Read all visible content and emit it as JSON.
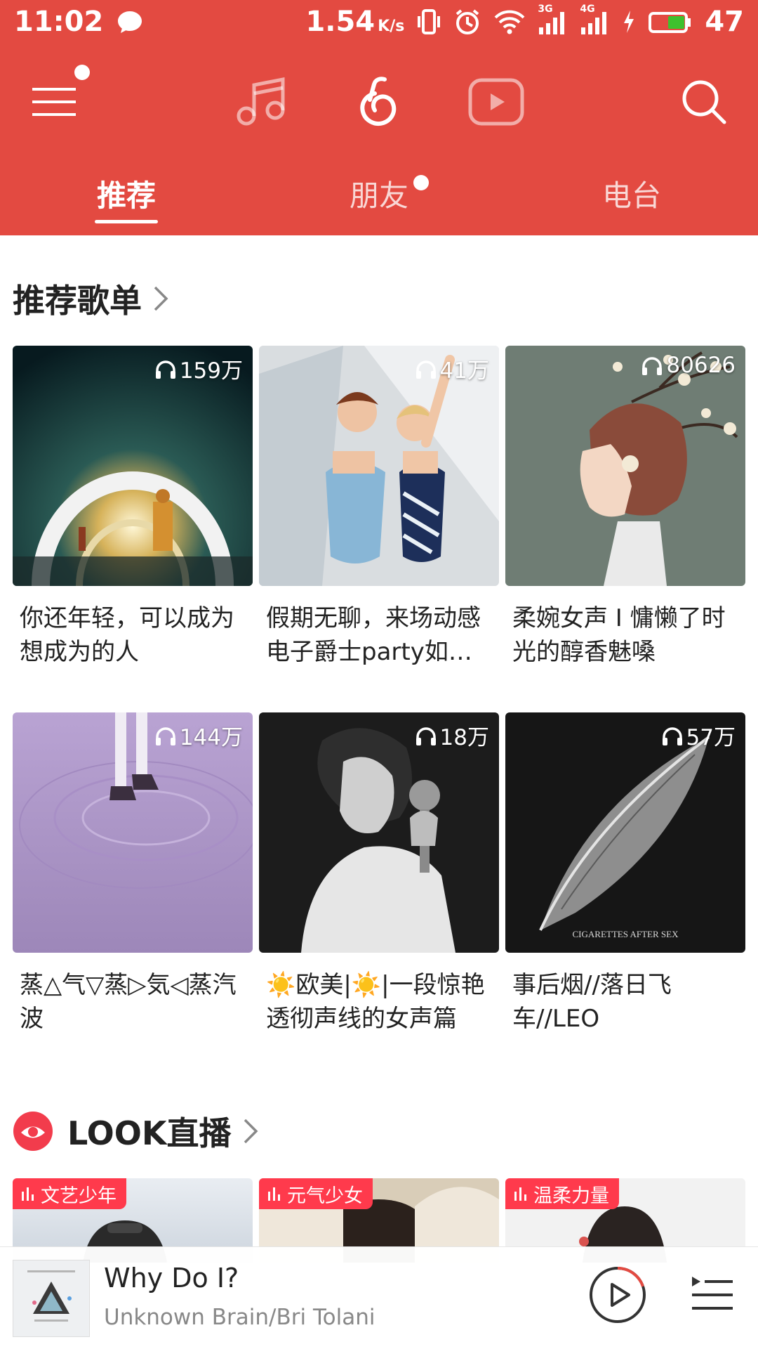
{
  "status_bar": {
    "time": "11:02",
    "net_speed": "1.54",
    "net_unit": "K/s",
    "net_3g": "3G",
    "net_4g": "4G",
    "battery": "47"
  },
  "top_nav": {
    "icons": [
      "menu-icon",
      "music-icon",
      "netease-logo-icon",
      "video-icon",
      "search-icon"
    ]
  },
  "tabs": [
    {
      "label": "推荐",
      "active": true
    },
    {
      "label": "朋友",
      "active": false
    },
    {
      "label": "电台",
      "active": false
    }
  ],
  "playlists_section": {
    "title": "推荐歌单",
    "items": [
      {
        "count": "159万",
        "title": "你还年轻，可以成为想成为的人"
      },
      {
        "count": "41万",
        "title": "假期无聊，来场动感电子爵士party如…"
      },
      {
        "count": "80626",
        "title": "柔婉女声 I 慵懒了时光的醇香魅嗓"
      },
      {
        "count": "144万",
        "title": "蒸△气▽蒸▷気◁蒸汽波"
      },
      {
        "count": "18万",
        "title": "☀️欧美|☀️|一段惊艳透彻声线的女声篇"
      },
      {
        "count": "57万",
        "title": "事后烟//落日飞车//LEO",
        "cover_text": "CIGARETTES AFTER SEX"
      }
    ]
  },
  "live_section": {
    "title": "LOOK直播",
    "items": [
      {
        "tag": "文艺少年"
      },
      {
        "tag": "元气少女"
      },
      {
        "tag": "温柔力量"
      }
    ]
  },
  "player": {
    "song": "Why Do I?",
    "artist": "Unknown Brain/Bri Tolani"
  },
  "colors": {
    "brand_red": "#e34a41",
    "live_tag_red": "#ff3a4c"
  }
}
